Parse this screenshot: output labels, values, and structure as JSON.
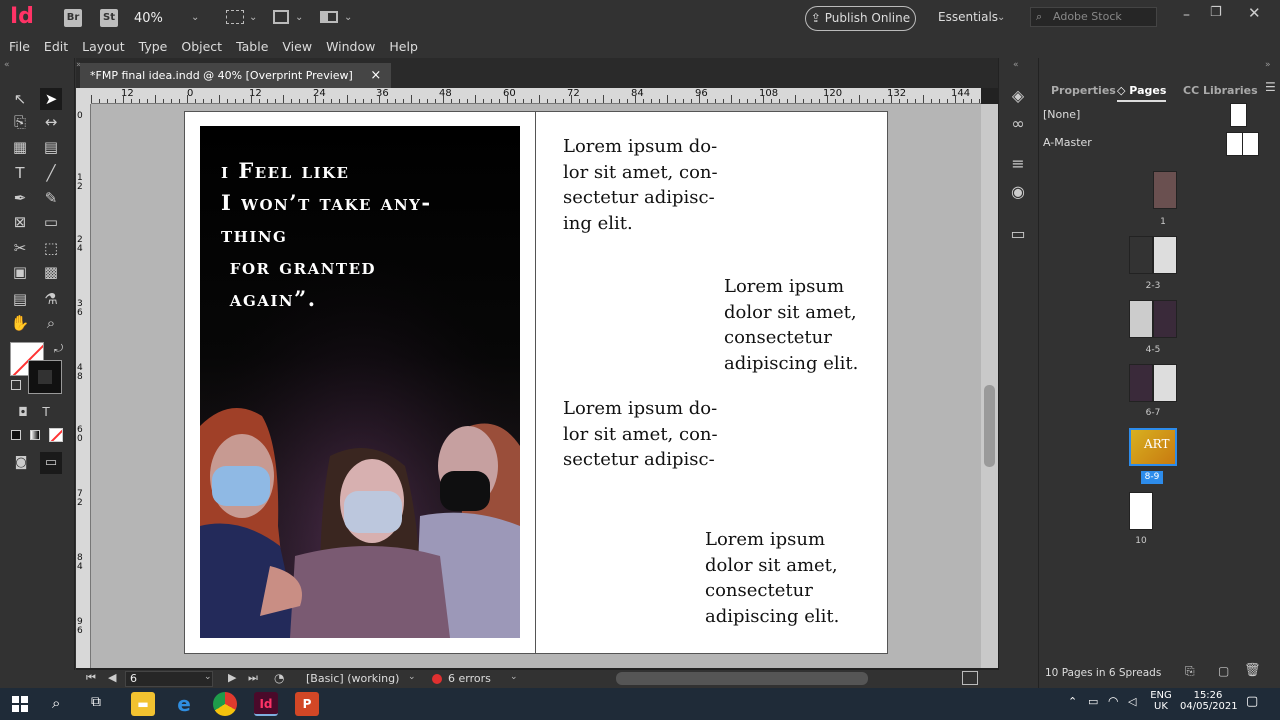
{
  "app": {
    "logo": "Id",
    "br": "Br",
    "st": "St",
    "zoom": "40%",
    "publish": "Publish Online",
    "workspace": "Essentials",
    "stock_placeholder": "Adobe Stock"
  },
  "menu": [
    "File",
    "Edit",
    "Layout",
    "Type",
    "Object",
    "Table",
    "View",
    "Window",
    "Help"
  ],
  "doc_tab": {
    "title": "*FMP final idea.indd @ 40% [Overprint Preview]",
    "close": "×"
  },
  "ruler_h": [
    "12",
    "0",
    "12",
    "24",
    "36",
    "48",
    "60",
    "72",
    "84",
    "96",
    "108",
    "120",
    "132",
    "144"
  ],
  "ruler_v": [
    "0",
    "1 2",
    "2 4",
    "3 6",
    "4 8",
    "6 0",
    "7 2",
    "8 4",
    "9 6"
  ],
  "left_page": {
    "quote_lines": [
      "i Feel like",
      "I won’t take any-",
      "thing",
      " for granted",
      " again”."
    ]
  },
  "right_page": {
    "block1": [
      "Lorem ipsum do-",
      "lor sit amet, con-",
      "sectetur adipisc-",
      "ing elit."
    ],
    "block2": [
      "Lorem ipsum",
      "dolor sit amet,",
      "consectetur",
      "adipiscing elit."
    ],
    "block3": [
      "Lorem ipsum do-",
      "lor sit amet, con-",
      "sectetur adipisc-"
    ],
    "block4": [
      "Lorem ipsum",
      "dolor sit amet,",
      "consectetur",
      "adipiscing elit."
    ]
  },
  "status": {
    "page": "6",
    "style": "[Basic] (working)",
    "errors": "6 errors"
  },
  "panel": {
    "tabs": [
      "Properties",
      "Pages",
      "CC Libraries"
    ],
    "none": "[None]",
    "master": "A-Master",
    "pages": [
      "1",
      "2-3",
      "4-5",
      "6-7",
      "8-9",
      "10"
    ],
    "art_text": "ART",
    "footer": "10 Pages in 6 Spreads"
  },
  "taskbar": {
    "lang": "ENG",
    "region": "UK",
    "time": "15:26",
    "date": "04/05/2021"
  },
  "colors": {
    "accent": "#ff3366",
    "selection": "#2d8ceb",
    "ai_red": "#ff3333"
  }
}
